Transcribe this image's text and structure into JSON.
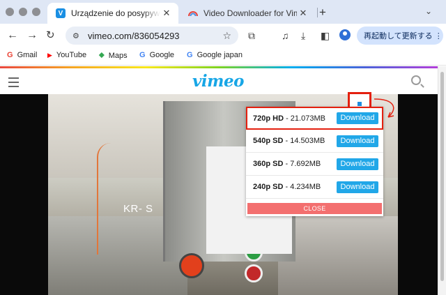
{
  "tabs": [
    {
      "title": "Urządzenie do posypywania m",
      "favicon": "V",
      "close": "✕"
    },
    {
      "title": "Video Downloader for Vimeo",
      "close": "✕"
    }
  ],
  "new_tab_symbol": "+",
  "toolbar": {
    "url": "vimeo.com/836054293",
    "restart_label": "再起動して更新する ⋮"
  },
  "bookmarks": [
    {
      "label": "Gmail",
      "icon": "G",
      "color": "#ea4335"
    },
    {
      "label": "YouTube",
      "icon": "▶",
      "color": "#ff0000"
    },
    {
      "label": "Maps",
      "icon": "⬥",
      "color": "#34a853"
    },
    {
      "label": "Google",
      "icon": "G",
      "color": "#4285f4"
    },
    {
      "label": "Google japan",
      "icon": "G",
      "color": "#4285f4"
    }
  ],
  "site": {
    "logo": "vimeo"
  },
  "video": {
    "label_text": "KR- S"
  },
  "downloader": {
    "options": [
      {
        "quality": "720p HD",
        "size": " - 21.073MB",
        "button": "Download"
      },
      {
        "quality": "540p SD",
        "size": " - 14.503MB",
        "button": "Download"
      },
      {
        "quality": "360p SD",
        "size": " - 7.692MB",
        "button": "Download"
      },
      {
        "quality": "240p SD",
        "size": " - 4.234MB",
        "button": "Download"
      }
    ],
    "close_label": "CLOSE",
    "highlight_color": "#e4200f",
    "button_color": "#21a7e8"
  }
}
